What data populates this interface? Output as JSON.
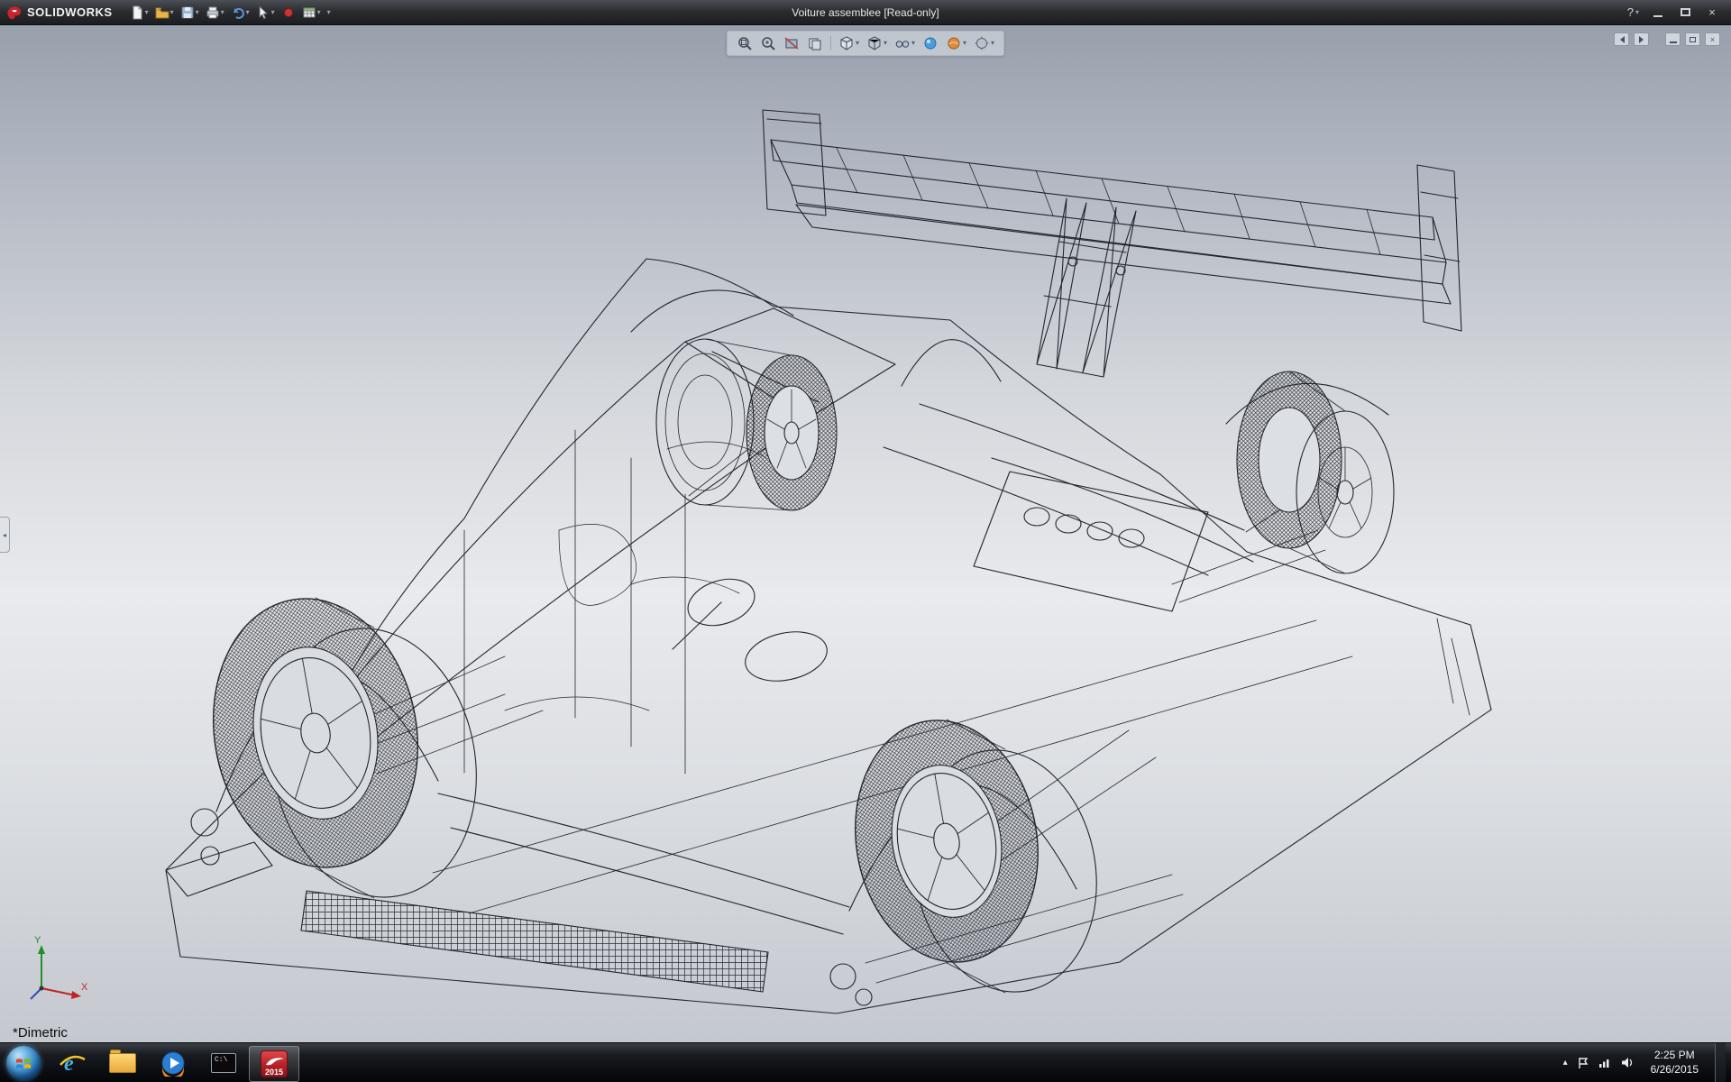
{
  "title_bar": {
    "brand": "SOLIDWORKS",
    "title": "Voiture assemblee [Read-only]",
    "help_glyph": "?",
    "close_glyph": "×",
    "dropdown_caret": "▾",
    "quick_toolbar_icons": [
      "new-document",
      "open",
      "save",
      "print",
      "undo",
      "select-cursor",
      "record-macro",
      "spreadsheet",
      "more-commands"
    ]
  },
  "hud_toolbar": {
    "icons": [
      "zoom-to-fit",
      "zoom-to-area",
      "section-view",
      "view-selector",
      "view-orientation",
      "display-style",
      "hide-show-items",
      "edit-appearance",
      "apply-scene",
      "view-settings"
    ]
  },
  "doc_window_controls": {
    "icons": [
      "previous-window",
      "next-window",
      "minimize-document",
      "restore-document",
      "close-document"
    ],
    "close_glyph": "×"
  },
  "viewport": {
    "view_orientation_label": "*Dimetric",
    "triad": {
      "x_label": "X",
      "y_label": "Y"
    }
  },
  "taskbar": {
    "items": [
      "start",
      "internet-explorer",
      "windows-explorer",
      "media-player",
      "command-prompt",
      "solidworks-2015"
    ],
    "ie_glyph": "e",
    "cmd_label": "C:\\",
    "solidworks_badge": "2015",
    "tray_caret": "▴",
    "clock_time": "2:25 PM",
    "clock_date": "6/26/2015"
  }
}
